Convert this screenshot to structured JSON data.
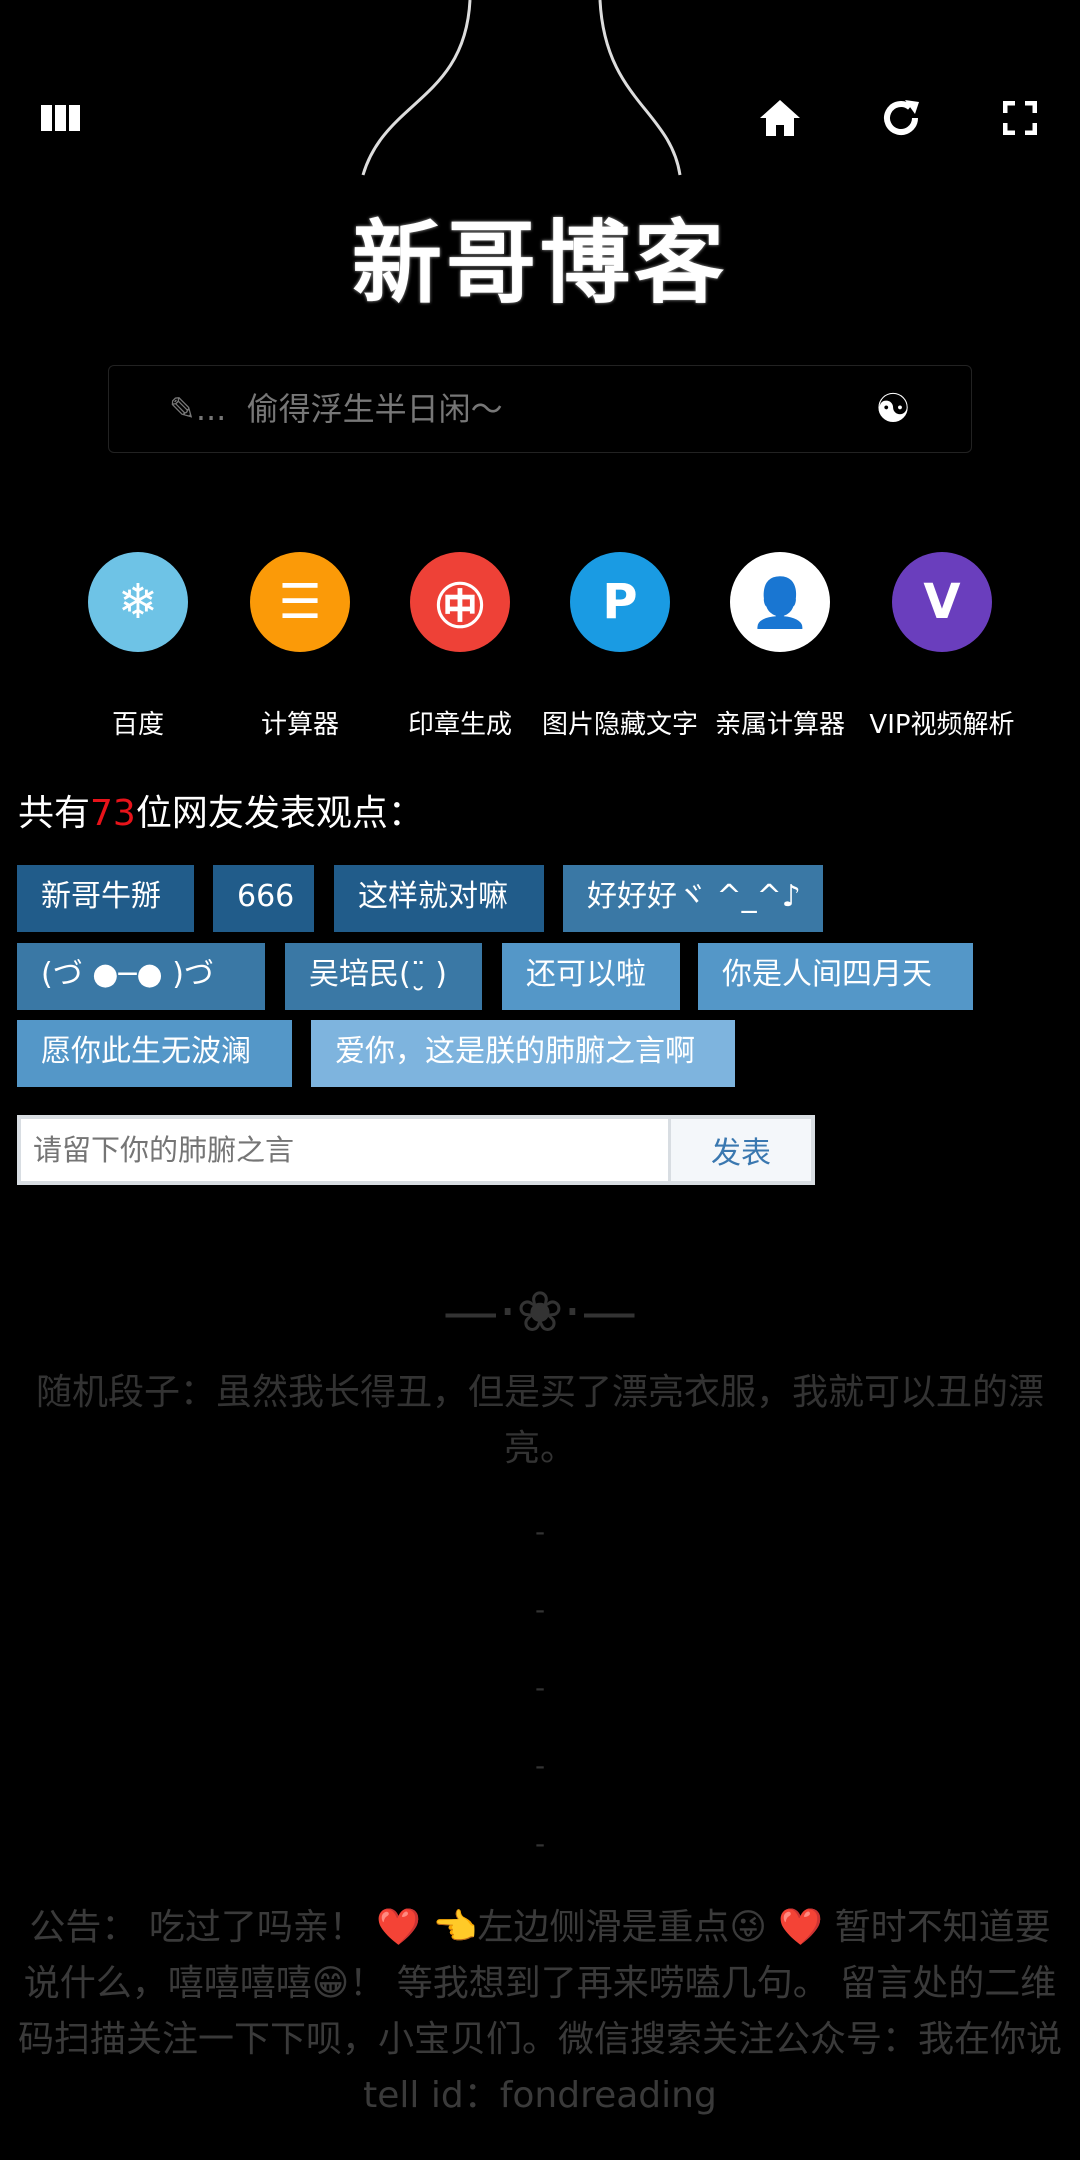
{
  "header": {
    "menu_icon": "columns-icon",
    "home_icon": "home-icon",
    "refresh_icon": "refresh-icon",
    "fullscreen_icon": "fullscreen-icon"
  },
  "logo": "新哥博客",
  "search": {
    "placeholder": "✎...  偷得浮生半日闲～",
    "engine_icon": "yin-yang-icon"
  },
  "shortcuts": [
    {
      "label": "百度",
      "icon": "snowflake-icon",
      "color": "#6ec3e6"
    },
    {
      "label": "计算器",
      "icon": "lines-icon",
      "color": "#fb9a08"
    },
    {
      "label": "印章生成",
      "icon": "seal-icon",
      "color": "#ee4137"
    },
    {
      "label": "图片隐藏文字",
      "icon": "p-icon",
      "color": "#1a9be3"
    },
    {
      "label": "亲属计算器",
      "icon": "person-icon",
      "color": "#ffffff"
    },
    {
      "label": "VIP视频解析",
      "icon": "v-icon",
      "color": "#6a3ebd"
    }
  ],
  "comments": {
    "prefix": "共有",
    "count": "73",
    "suffix": "位网友发表观点：",
    "tags": [
      "新哥牛掰",
      "666",
      "这样就对嘛",
      "好好好ヾ ^_^♪",
      "(づ ●─● )づ",
      "吴培民(¨̮ )",
      "还可以啦",
      "你是人间四月天",
      "愿你此生无波澜",
      "爱你，这是朕的肺腑之言啊"
    ],
    "input_placeholder": "请留下你的肺腑之言",
    "submit": "发表"
  },
  "ornament": "—·❀·—",
  "joke": "随机段子：虽然我长得丑，但是买了漂亮衣服，我就可以丑的漂亮。",
  "dashes": [
    "-",
    "-",
    "-",
    "-",
    "-"
  ],
  "notice": "公告： 吃过了吗亲！ ❤️ 👈左边侧滑是重点😜 ❤️ 暂时不知道要说什么，嘻嘻嘻嘻😁！ 等我想到了再来唠嗑几句。 留言处的二维码扫描关注一下下呗，小宝贝们。微信搜索关注公众号：我在你说tell id：fondreading"
}
